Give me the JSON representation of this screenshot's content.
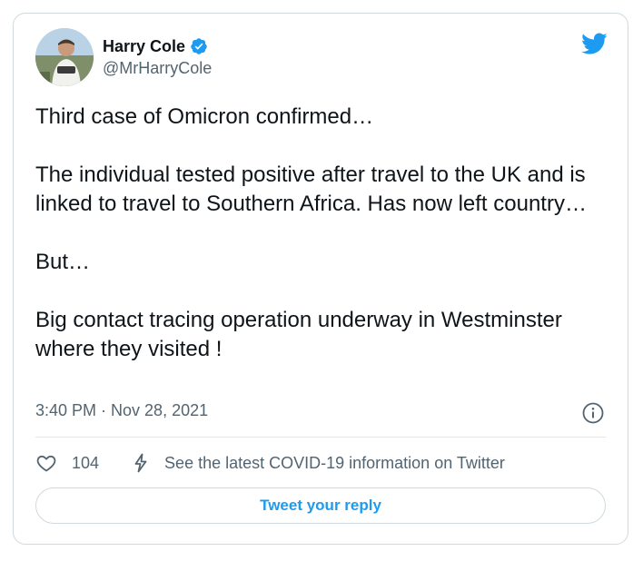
{
  "author": {
    "name": "Harry Cole",
    "handle": "@MrHarryCole",
    "verified": true,
    "avatar_icon": "profile-photo"
  },
  "tweet": {
    "paragraphs": [
      "Third case of Omicron confirmed…",
      "The individual tested positive after travel to the UK and is linked to travel to Southern Africa. Has now left country…",
      "But…",
      "Big contact tracing operation underway in Westminster where they visited !"
    ],
    "timestamp": "3:40 PM · Nov 28, 2021"
  },
  "actions": {
    "like_count": "104",
    "covid_info": "See the latest COVID-19 information on Twitter",
    "reply_label": "Tweet your reply"
  },
  "colors": {
    "brand": "#1d9bf0",
    "text": "#0f1419",
    "muted": "#536471",
    "border": "#cfd9de"
  },
  "icons": {
    "logo": "twitter-bird-icon",
    "verified": "verified-badge-icon",
    "info": "info-icon",
    "like": "heart-icon",
    "covid": "lightning-bolt-icon"
  }
}
